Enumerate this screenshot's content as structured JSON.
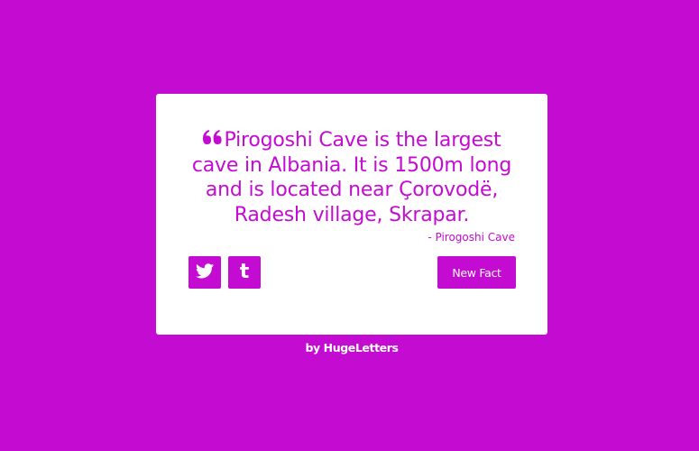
{
  "quote": {
    "icon": "quote-left-icon",
    "text": "Pirogoshi Cave is the largest cave in Albania. It is 1500m long and is located near Çorovodë, Radesh village, Skrapar.",
    "author": "- Pirogoshi Cave"
  },
  "share": {
    "twitter_icon": "twitter-icon",
    "tumblr_icon": "tumblr-icon",
    "tumblr_glyph": "t"
  },
  "actions": {
    "new_fact_label": "New Fact"
  },
  "footer": {
    "credit": "by HugeLetters"
  },
  "colors": {
    "accent": "#c30bd2",
    "card": "#ffffff"
  }
}
